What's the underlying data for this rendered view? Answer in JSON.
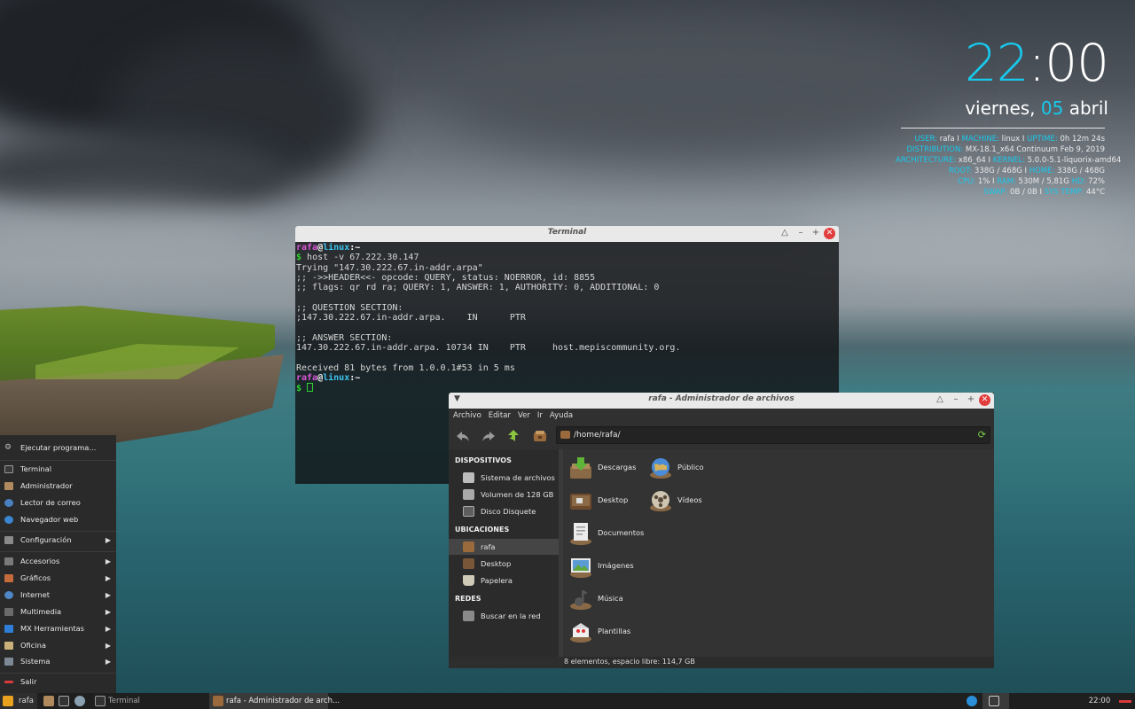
{
  "conky": {
    "hours": "22",
    "minutes": ":00",
    "weekday": "viernes,",
    "day": "05",
    "month": "abril",
    "rows": [
      [
        {
          "k": "USER:",
          "v": " rafa"
        },
        {
          "s": " I "
        },
        {
          "k": "MACHINE:",
          "v": " linux"
        },
        {
          "s": " I "
        },
        {
          "k": "UPTIME:",
          "v": " 0h 12m 24s"
        }
      ],
      [
        {
          "k": "DISTRIBUTION:",
          "v": " MX-18.1_x64 Continuum Feb 9, 2019"
        }
      ],
      [
        {
          "k": "ARCHITECTURE:",
          "v": " x86_64"
        },
        {
          "s": " I "
        },
        {
          "k": "KERNEL:",
          "v": " 5.0.0-5.1-liquorix-amd64"
        }
      ],
      [
        {
          "k": "ROOT:",
          "v": " 338G / 468G"
        },
        {
          "s": " I "
        },
        {
          "k": "HOME:",
          "v": " 338G / 468G"
        }
      ],
      [
        {
          "k": "CPU:",
          "v": " 1%"
        },
        {
          "s": " I "
        },
        {
          "k": "RAM:",
          "v": " 530M / 5,81G"
        },
        {
          "s": " "
        },
        {
          "k": "HD:",
          "v": " 72%"
        }
      ],
      [
        {
          "k": "SWAP:",
          "v": " 0B / 0B"
        },
        {
          "s": " I "
        },
        {
          "k": "SYS TEMP:",
          "v": " 44°C"
        }
      ]
    ],
    "accent_color": "#17c9ec"
  },
  "terminal": {
    "title": "Terminal",
    "lines": [
      {
        "type": "prompt",
        "user": "rafa",
        "host": "linux",
        "path": ":~"
      },
      {
        "type": "cmd",
        "text": "host -v 67.222.30.147"
      },
      {
        "type": "out",
        "text": "Trying \"147.30.222.67.in-addr.arpa\""
      },
      {
        "type": "out",
        "text": ";; ->>HEADER<<- opcode: QUERY, status: NOERROR, id: 8855"
      },
      {
        "type": "out",
        "text": ";; flags: qr rd ra; QUERY: 1, ANSWER: 1, AUTHORITY: 0, ADDITIONAL: 0"
      },
      {
        "type": "out",
        "text": ""
      },
      {
        "type": "out",
        "text": ";; QUESTION SECTION:"
      },
      {
        "type": "out",
        "text": ";147.30.222.67.in-addr.arpa.    IN      PTR"
      },
      {
        "type": "out",
        "text": ""
      },
      {
        "type": "out",
        "text": ";; ANSWER SECTION:"
      },
      {
        "type": "out",
        "text": "147.30.222.67.in-addr.arpa. 10734 IN    PTR     host.mepiscommunity.org."
      },
      {
        "type": "out",
        "text": ""
      },
      {
        "type": "out",
        "text": "Received 81 bytes from 1.0.0.1#53 in 5 ms"
      },
      {
        "type": "prompt",
        "user": "rafa",
        "host": "linux",
        "path": ":~"
      },
      {
        "type": "cursor"
      }
    ]
  },
  "file_manager": {
    "title": "rafa - Administrador de archivos",
    "menu": [
      "Archivo",
      "Editar",
      "Ver",
      "Ir",
      "Ayuda"
    ],
    "location": "/home/rafa/",
    "sidebar": {
      "devices_header": "DISPOSITIVOS",
      "devices": [
        "Sistema de archivos",
        "Volumen de 128 GB",
        "Disco Disquete"
      ],
      "places_header": "UBICACIONES",
      "places": [
        "rafa",
        "Desktop",
        "Papelera"
      ],
      "network_header": "REDES",
      "network": [
        "Buscar en la red"
      ]
    },
    "items": [
      {
        "label": "Descargas",
        "icon": "downloads-folder-icon"
      },
      {
        "label": "Público",
        "icon": "public-folder-icon"
      },
      {
        "label": "Desktop",
        "icon": "desktop-folder-icon"
      },
      {
        "label": "Vídeos",
        "icon": "videos-folder-icon"
      },
      {
        "label": "Documentos",
        "icon": "documents-folder-icon"
      },
      {
        "label": "Imágenes",
        "icon": "pictures-folder-icon"
      },
      {
        "label": "Música",
        "icon": "music-folder-icon"
      },
      {
        "label": "Plantillas",
        "icon": "templates-folder-icon"
      }
    ],
    "status": "8 elementos, espacio libre: 114,7 GB"
  },
  "app_menu": {
    "run": "Ejecutar programa...",
    "favorites": [
      "Terminal",
      "Administrador",
      "Lector de correo",
      "Navegador web"
    ],
    "settings": "Configuración",
    "categories": [
      "Accesorios",
      "Gráficos",
      "Internet",
      "Multimedia",
      "MX Herramientas",
      "Oficina",
      "Sistema"
    ],
    "logout": "Salir"
  },
  "taskbar": {
    "menu_label": "rafa",
    "task_terminal": "Terminal",
    "task_fm": "rafa - Administrador de arch...",
    "clock": "22:00"
  }
}
